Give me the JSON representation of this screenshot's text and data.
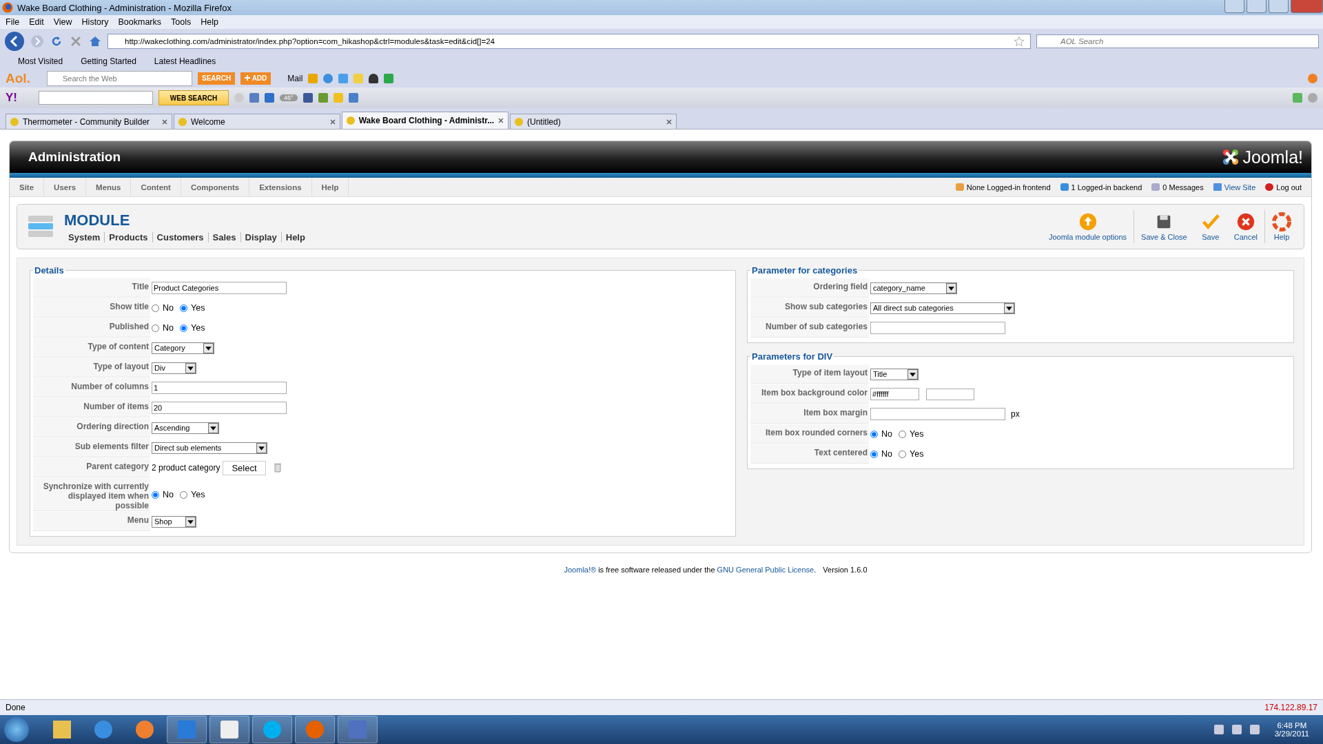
{
  "window": {
    "title": "Wake Board Clothing - Administration - Mozilla Firefox"
  },
  "menu_bar": [
    "File",
    "Edit",
    "View",
    "History",
    "Bookmarks",
    "Tools",
    "Help"
  ],
  "address_bar": {
    "url": "http://wakeclothing.com/administrator/index.php?option=com_hikashop&ctrl=modules&task=edit&cid[]=24"
  },
  "search_bar": {
    "placeholder": "AOL Search"
  },
  "bookmarks": [
    "Most Visited",
    "Getting Started",
    "Latest Headlines"
  ],
  "aol_toolbar": {
    "logo": "Aol.",
    "search_placeholder": "Search the Web",
    "search_button": "SEARCH",
    "add_button": "ADD",
    "mail": "Mail"
  },
  "yahoo_toolbar": {
    "logo": "Y!",
    "search_button": "WEB SEARCH",
    "weather": "46°"
  },
  "tabs": [
    {
      "label": "Thermometer - Community Builder",
      "selected": false
    },
    {
      "label": "Welcome",
      "selected": false
    },
    {
      "label": "Wake Board Clothing - Administr...",
      "selected": true
    },
    {
      "label": "(Untitled)",
      "selected": false
    }
  ],
  "admin": {
    "title": "Administration",
    "brand": "Joomla!"
  },
  "admin_menu": [
    "Site",
    "Users",
    "Menus",
    "Content",
    "Components",
    "Extensions",
    "Help"
  ],
  "status_links": [
    {
      "kind": "frontend",
      "label": "None Logged-in frontend"
    },
    {
      "kind": "backend",
      "label": "1 Logged-in backend"
    },
    {
      "kind": "messages",
      "label": "0 Messages"
    },
    {
      "kind": "site",
      "label": "View Site"
    },
    {
      "kind": "logout",
      "label": "Log out"
    }
  ],
  "toolbar": {
    "title": "MODULE",
    "submenu": [
      "System",
      "Products",
      "Customers",
      "Sales",
      "Display",
      "Help"
    ],
    "buttons": [
      {
        "kind": "options",
        "label": "Joomla module options"
      },
      {
        "kind": "save-close",
        "label": "Save & Close"
      },
      {
        "kind": "save",
        "label": "Save"
      },
      {
        "kind": "cancel",
        "label": "Cancel"
      },
      {
        "kind": "help",
        "label": "Help"
      }
    ]
  },
  "details": {
    "legend": "Details",
    "rows": [
      {
        "kind": "text",
        "label": "Title",
        "value": "Product Categories"
      },
      {
        "kind": "radio",
        "label": "Show title",
        "options": [
          {
            "label": "No",
            "selected": false
          },
          {
            "label": "Yes",
            "selected": true
          }
        ]
      },
      {
        "kind": "radio",
        "label": "Published",
        "options": [
          {
            "label": "No",
            "selected": false
          },
          {
            "label": "Yes",
            "selected": true
          }
        ]
      },
      {
        "kind": "select",
        "label": "Type of content",
        "value": "Category"
      },
      {
        "kind": "select",
        "label": "Type of layout",
        "value": "Div"
      },
      {
        "kind": "text",
        "label": "Number of columns",
        "value": "1"
      },
      {
        "kind": "text",
        "label": "Number of items",
        "value": "20"
      },
      {
        "kind": "select",
        "label": "Ordering direction",
        "value": "Ascending"
      },
      {
        "kind": "select",
        "label": "Sub elements filter",
        "value": "Direct sub elements"
      },
      {
        "kind": "picker",
        "label": "Parent category",
        "value": "2 product category",
        "button": "Select"
      },
      {
        "kind": "radio",
        "label": "Synchronize with currently displayed item when possible",
        "options": [
          {
            "label": "No",
            "selected": true
          },
          {
            "label": "Yes",
            "selected": false
          }
        ]
      },
      {
        "kind": "select",
        "label": "Menu",
        "value": "Shop"
      }
    ]
  },
  "categories": {
    "legend": "Parameter for categories",
    "rows": [
      {
        "kind": "select",
        "label": "Ordering field",
        "value": "category_name"
      },
      {
        "kind": "select",
        "label": "Show sub categories",
        "value": "All direct sub categories"
      },
      {
        "kind": "text",
        "label": "Number of sub categories"
      }
    ]
  },
  "div_params": {
    "legend": "Parameters for DIV",
    "rows": [
      {
        "kind": "select",
        "label": "Type of item layout",
        "value": "Title"
      },
      {
        "kind": "color",
        "label": "Item box background color",
        "value": "#ffffff"
      },
      {
        "kind": "text",
        "label": "Item box margin",
        "unit": "px"
      },
      {
        "kind": "radio",
        "label": "Item box rounded corners",
        "options": [
          {
            "label": "No",
            "selected": true
          },
          {
            "label": "Yes",
            "selected": false
          }
        ]
      },
      {
        "kind": "radio",
        "label": "Text centered",
        "options": [
          {
            "label": "No",
            "selected": true
          },
          {
            "label": "Yes",
            "selected": false
          }
        ]
      }
    ]
  },
  "footer": {
    "link": "Joomla!®",
    "text": " is free software released under the ",
    "license": "GNU General Public License",
    "end": ".",
    "version": "Version 1.6.0"
  },
  "status_bar": {
    "text": "Done",
    "address": "174.122.89.17"
  },
  "taskbar": {
    "time": "6:48 PM",
    "date": "3/29/2011"
  }
}
